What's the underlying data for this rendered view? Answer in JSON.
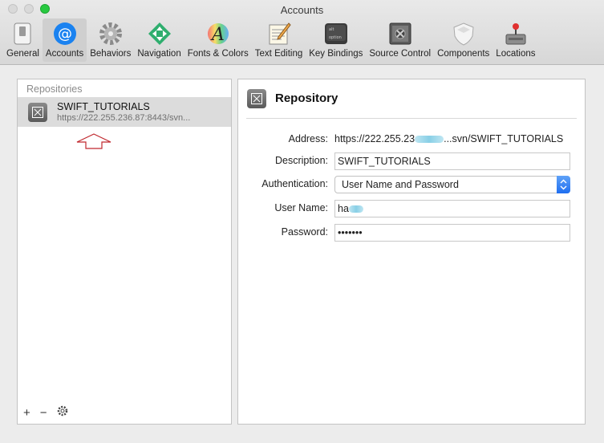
{
  "window": {
    "title": "Accounts"
  },
  "toolbar": {
    "tabs": [
      {
        "label": "General",
        "icon": "switch-icon"
      },
      {
        "label": "Accounts",
        "icon": "at-icon"
      },
      {
        "label": "Behaviors",
        "icon": "gear-icon"
      },
      {
        "label": "Navigation",
        "icon": "navigation-arrows-icon"
      },
      {
        "label": "Fonts & Colors",
        "icon": "font-a-icon"
      },
      {
        "label": "Text Editing",
        "icon": "notepad-pencil-icon"
      },
      {
        "label": "Key Bindings",
        "icon": "keyboard-key-icon"
      },
      {
        "label": "Source Control",
        "icon": "vault-icon"
      },
      {
        "label": "Components",
        "icon": "shield-icon"
      },
      {
        "label": "Locations",
        "icon": "disk-joystick-icon"
      }
    ],
    "selected": "Accounts"
  },
  "left": {
    "header": "Repositories",
    "items": [
      {
        "name": "SWIFT_TUTORIALS",
        "url": "https://222.255.236.87:8443/svn..."
      }
    ],
    "tools": {
      "add": "+",
      "remove": "−"
    }
  },
  "detail": {
    "title": "Repository",
    "address_label": "Address:",
    "address_prefix": "https://222.255.23",
    "address_suffix": "...svn/SWIFT_TUTORIALS",
    "description_label": "Description:",
    "description_value": "SWIFT_TUTORIALS",
    "auth_label": "Authentication:",
    "auth_value": "User Name and Password",
    "username_label": "User Name:",
    "username_value": "ha",
    "password_label": "Password:",
    "password_value": "•••••••"
  },
  "colors": {
    "accent": "#1f6ef0",
    "annotation": "#c0282e",
    "selected_row": "#dcdcdc"
  }
}
